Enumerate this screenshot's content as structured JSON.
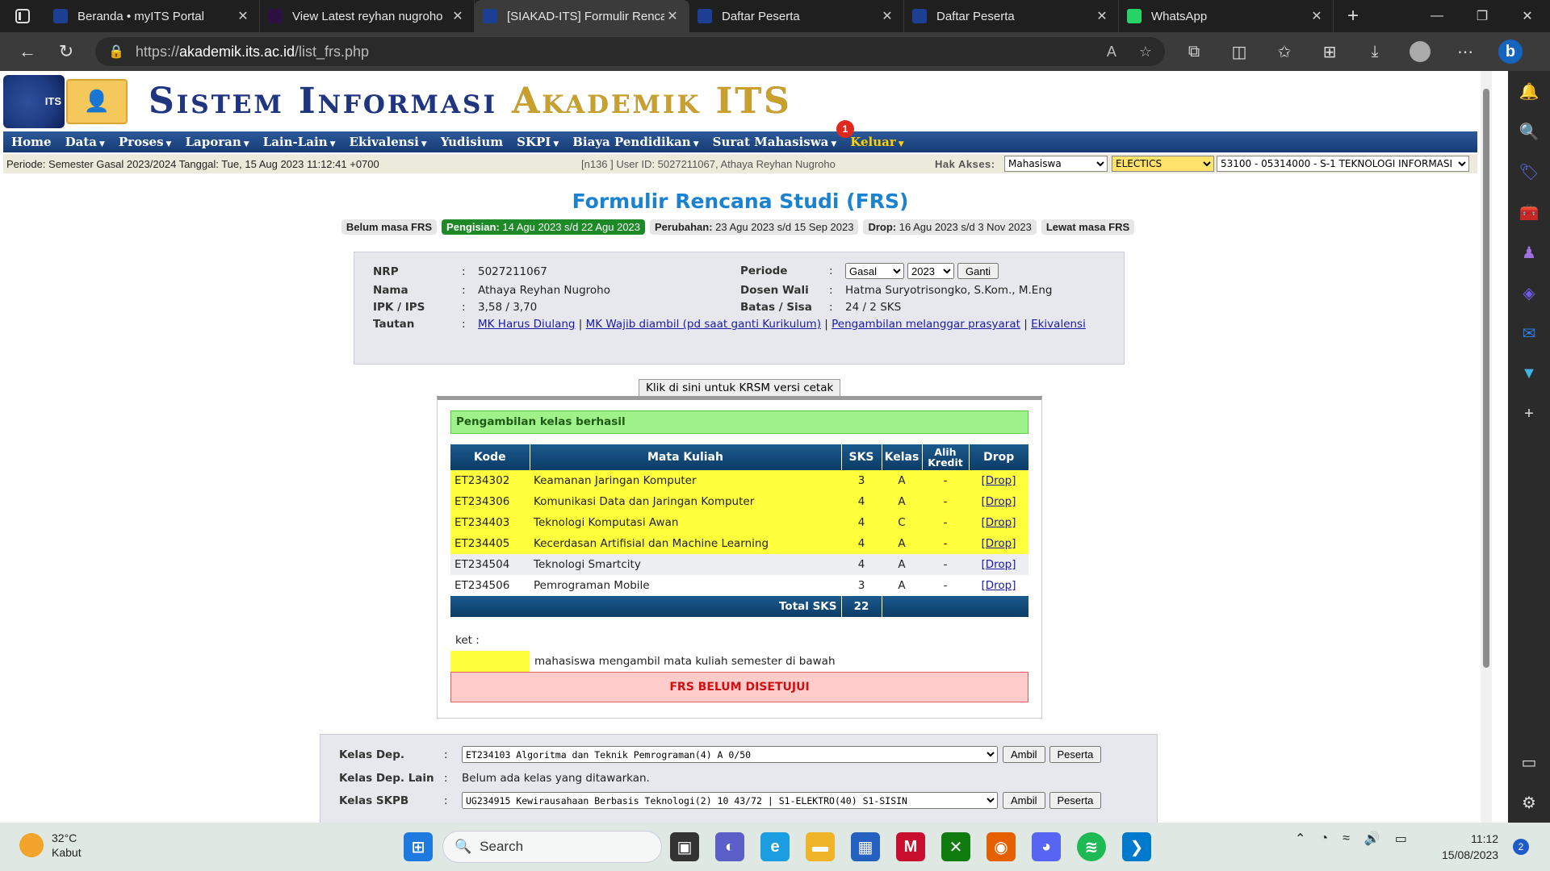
{
  "browser": {
    "tabs": [
      {
        "title": "Beranda • myITS Portal",
        "favicon": "its-icon",
        "color": "#1c3f93"
      },
      {
        "title": "View Latest reyhan nugroho",
        "favicon": "vercel-icon",
        "color": "#2b1040"
      },
      {
        "title": "[SIAKAD-ITS] Formulir Renca",
        "favicon": "its-icon",
        "color": "#1c3f93",
        "active": true
      },
      {
        "title": "Daftar Peserta",
        "favicon": "its-icon",
        "color": "#1c3f93"
      },
      {
        "title": "Daftar Peserta",
        "favicon": "its-icon",
        "color": "#1c3f93"
      },
      {
        "title": "WhatsApp",
        "favicon": "whatsapp-icon",
        "color": "#25d366"
      }
    ],
    "url_prefix": "https://",
    "url_host": "akademik.its.ac.id",
    "url_path": "/list_frs.php"
  },
  "site": {
    "title_1": "Sistem Informasi ",
    "title_2": "Akademik ITS",
    "logo_text": "ITS",
    "menu": [
      "Home",
      "Data",
      "Proses",
      "Laporan",
      "Lain-Lain",
      "Ekivalensi",
      "Yudisium",
      "SKPI",
      "Biaya Pendidikan",
      "Surat Mahasiswa",
      "Keluar"
    ],
    "notif_count": "1",
    "periode_text": "Periode: Semester Gasal 2023/2024 Tanggal: Tue, 15 Aug 2023 11:12:41 +0700",
    "user_text": "[n136 ] User ID: 5027211067, Athaya Reyhan Nugroho",
    "hak_akses_label": "Hak Akses:",
    "hak_akses_value": "Mahasiswa",
    "prodi_value": "ELECTICS",
    "unit_value": "53100 - 05314000 - S-1 TEKNOLOGI INFORMASI"
  },
  "frs": {
    "title": "Formulir Rencana Studi (FRS)",
    "periods": [
      {
        "label": "Belum masa FRS",
        "value": ""
      },
      {
        "label": "Pengisian:",
        "value": " 14 Agu 2023 s/d 22 Agu 2023"
      },
      {
        "label": "Perubahan:",
        "value": " 23 Agu 2023 s/d 15 Sep 2023"
      },
      {
        "label": "Drop:",
        "value": " 16 Agu 2023 s/d 3 Nov 2023"
      },
      {
        "label": "Lewat masa FRS",
        "value": ""
      }
    ],
    "student": {
      "nrp_label": "NRP",
      "nrp": "5027211067",
      "nama_label": "Nama",
      "nama": "Athaya Reyhan Nugroho",
      "ipk_label": "IPK / IPS",
      "ipk": "3,58 / 3,70",
      "tautan_label": "Tautan",
      "links": [
        "MK Harus Diulang",
        "MK Wajib diambil (pd saat ganti Kurikulum)",
        "Pengambilan melanggar prasyarat",
        "Ekivalensi"
      ],
      "periode_label": "Periode",
      "semester": "Gasal",
      "tahun": "2023",
      "ganti": "Ganti",
      "dosen_label": "Dosen Wali",
      "dosen": "Hatma Suryotrisongko, S.Kom., M.Eng",
      "batas_label": "Batas / Sisa",
      "batas": "24 / 2 SKS",
      "colon": ":"
    },
    "cetak_button": "Klik di sini untuk KRSM versi cetak",
    "success_msg": "Pengambilan kelas berhasil",
    "table_headers": [
      "Kode",
      "Mata Kuliah",
      "SKS",
      "Kelas",
      "Alih Kredit",
      "Drop"
    ],
    "courses": [
      {
        "kode": "ET234302",
        "mk": "Keamanan Jaringan Komputer",
        "sks": "3",
        "kelas": "A",
        "alih": "-",
        "drop": "[Drop]",
        "hl": true
      },
      {
        "kode": "ET234306",
        "mk": "Komunikasi Data dan Jaringan Komputer",
        "sks": "4",
        "kelas": "A",
        "alih": "-",
        "drop": "[Drop]",
        "hl": true
      },
      {
        "kode": "ET234403",
        "mk": "Teknologi Komputasi Awan",
        "sks": "4",
        "kelas": "C",
        "alih": "-",
        "drop": "[Drop]",
        "hl": true
      },
      {
        "kode": "ET234405",
        "mk": "Kecerdasan Artifisial dan Machine Learning",
        "sks": "4",
        "kelas": "A",
        "alih": "-",
        "drop": "[Drop]",
        "hl": true
      },
      {
        "kode": "ET234504",
        "mk": "Teknologi Smartcity",
        "sks": "4",
        "kelas": "A",
        "alih": "-",
        "drop": "[Drop]",
        "hl": false
      },
      {
        "kode": "ET234506",
        "mk": "Pemrograman Mobile",
        "sks": "3",
        "kelas": "A",
        "alih": "-",
        "drop": "[Drop]",
        "hl": false
      }
    ],
    "total_label": "Total SKS",
    "total_sks": "22",
    "ket_label": "ket :",
    "ket_text": "mahasiswa mengambil mata kuliah semester di bawah",
    "status": "FRS BELUM DISETUJUI",
    "highlight_color": "#ffff3b"
  },
  "kelas": {
    "dep_label": "Kelas Dep.",
    "dep_value": "ET234103 Algoritma dan Teknik Pemrograman(4) A 0/50",
    "deplain_label": "Kelas Dep. Lain",
    "deplain_value": "Belum ada kelas yang ditawarkan.",
    "skpb_label": "Kelas SKPB",
    "skpb_value": "UG234915 Kewirausahaan Berbasis Teknologi(2) 10  43/72 | S1-ELEKTRO(40) S1-SISIN",
    "ambil": "Ambil",
    "peserta": "Peserta"
  },
  "taskbar": {
    "temp": "32°C",
    "weather": "Kabut",
    "search": "Search",
    "time": "11:12",
    "date": "15/08/2023",
    "notifications": "2"
  }
}
